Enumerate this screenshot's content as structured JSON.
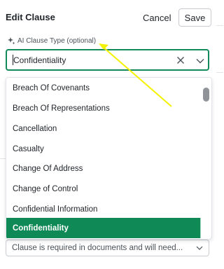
{
  "header": {
    "title": "Edit Clause",
    "cancel_label": "Cancel",
    "save_label": "Save"
  },
  "clause_type": {
    "label": "AI Clause Type (optional)",
    "value": "Confidentiality"
  },
  "dropdown": {
    "options": [
      "Breach Of Covenants",
      "Breach Of Representations",
      "Cancellation",
      "Casualty",
      "Change Of Address",
      "Change of Control",
      "Confidential Information",
      "Confidentiality"
    ],
    "selected_index": 7
  },
  "requirement": {
    "value": "Clause is required in documents and will need..."
  },
  "colors": {
    "accent": "#0f8a57",
    "annotation_arrow": "#f5f200"
  },
  "icons": {
    "label_icon": "sparkle-icon",
    "clear_icon": "close-icon",
    "toggle_icon": "chevron-down-icon"
  }
}
